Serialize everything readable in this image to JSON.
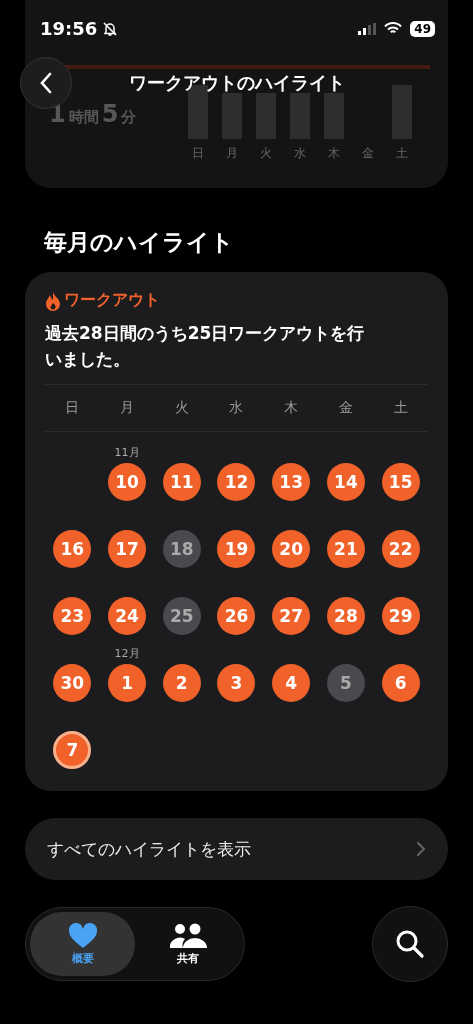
{
  "status_bar": {
    "time": "19:56",
    "battery": "49"
  },
  "nav": {
    "title": "ワークアウトのハイライト"
  },
  "summary_card": {
    "duration": [
      {
        "kind": "number",
        "text": "1"
      },
      {
        "kind": "unit",
        "text": "時間"
      },
      {
        "kind": "number",
        "text": "5"
      },
      {
        "kind": "unit",
        "text": "分"
      }
    ],
    "weekdays": [
      "日",
      "月",
      "火",
      "水",
      "木",
      "金",
      "土"
    ]
  },
  "section_title": "毎月のハイライト",
  "highlight_card": {
    "category": "ワークアウト",
    "summary": "過去28日間のうち25日ワークアウトを行いました。",
    "weekdays": [
      "日",
      "月",
      "火",
      "水",
      "木",
      "金",
      "土"
    ],
    "weeks": [
      [
        {
          "kind": "blank"
        },
        {
          "kind": "done",
          "day": "10",
          "month": "11月"
        },
        {
          "kind": "done",
          "day": "11"
        },
        {
          "kind": "done",
          "day": "12"
        },
        {
          "kind": "done",
          "day": "13"
        },
        {
          "kind": "done",
          "day": "14"
        },
        {
          "kind": "done",
          "day": "15"
        }
      ],
      [
        {
          "kind": "done",
          "day": "16"
        },
        {
          "kind": "done",
          "day": "17"
        },
        {
          "kind": "missed",
          "day": "18"
        },
        {
          "kind": "done",
          "day": "19"
        },
        {
          "kind": "done",
          "day": "20"
        },
        {
          "kind": "done",
          "day": "21"
        },
        {
          "kind": "done",
          "day": "22"
        }
      ],
      [
        {
          "kind": "done",
          "day": "23"
        },
        {
          "kind": "done",
          "day": "24"
        },
        {
          "kind": "missed",
          "day": "25"
        },
        {
          "kind": "done",
          "day": "26"
        },
        {
          "kind": "done",
          "day": "27"
        },
        {
          "kind": "done",
          "day": "28"
        },
        {
          "kind": "done",
          "day": "29"
        }
      ],
      [
        {
          "kind": "done",
          "day": "30"
        },
        {
          "kind": "done",
          "day": "1",
          "month": "12月"
        },
        {
          "kind": "done",
          "day": "2"
        },
        {
          "kind": "done",
          "day": "3"
        },
        {
          "kind": "done",
          "day": "4"
        },
        {
          "kind": "missed",
          "day": "5"
        },
        {
          "kind": "done",
          "day": "6"
        }
      ],
      [
        {
          "kind": "today",
          "day": "7"
        }
      ]
    ]
  },
  "show_all": "すべてのハイライトを表示",
  "tabs": [
    {
      "label": "概要",
      "selected": true
    },
    {
      "label": "共有",
      "selected": false
    }
  ]
}
